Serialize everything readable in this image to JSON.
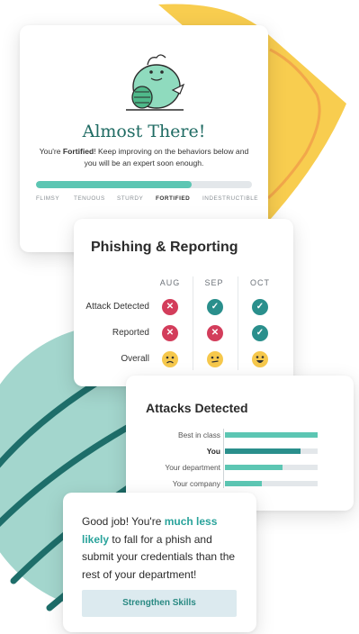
{
  "colors": {
    "accent_teal": "#2a8f8c",
    "bar_fill": "#5cc6b3",
    "danger": "#d33d5b",
    "warning": "#f6c84c",
    "shape_yellow": "#f8cd4f",
    "shape_circle": "#a3d6cd"
  },
  "progress_card": {
    "title": "Almost There!",
    "message_prefix": "You're ",
    "message_level": "Fortified",
    "message_suffix": "! Keep improving on the behaviors below and you will be an expert soon enough.",
    "levels": [
      "FLIMSY",
      "TENUOUS",
      "STURDY",
      "FORTIFIED",
      "INDESTRUCTIBLE"
    ],
    "current_level": "FORTIFIED",
    "progress_fraction": 0.72,
    "illustration_icon": "monster-illustration-icon"
  },
  "phishing_card": {
    "title": "Phishing & Reporting",
    "months": [
      "AUG",
      "SEP",
      "OCT"
    ],
    "rows": [
      {
        "label": "Attack Detected",
        "statuses": [
          "x-icon",
          "check-icon",
          "check-icon"
        ]
      },
      {
        "label": "Reported",
        "statuses": [
          "x-icon",
          "x-icon",
          "check-icon"
        ]
      },
      {
        "label": "Overall",
        "statuses": [
          "sad-face-icon",
          "meh-face-icon",
          "happy-face-icon"
        ]
      }
    ]
  },
  "attacks_card": {
    "title": "Attacks Detected",
    "bars": [
      {
        "label": "Best in class",
        "value": 1.0,
        "color": "#5cc6b3",
        "bold": false
      },
      {
        "label": "You",
        "value": 0.82,
        "color": "#2a8f8c",
        "bold": true
      },
      {
        "label": "Your department",
        "value": 0.62,
        "color": "#5cc6b3",
        "bold": false
      },
      {
        "label": "Your company",
        "value": 0.4,
        "color": "#5cc6b3",
        "bold": false
      }
    ]
  },
  "goodjob_card": {
    "text_prefix": "Good job! You're ",
    "text_highlight": "much less likely",
    "text_suffix": " to fall for a phish and submit your credentials than the rest of your department!",
    "button_label": "Strengthen Skills"
  }
}
